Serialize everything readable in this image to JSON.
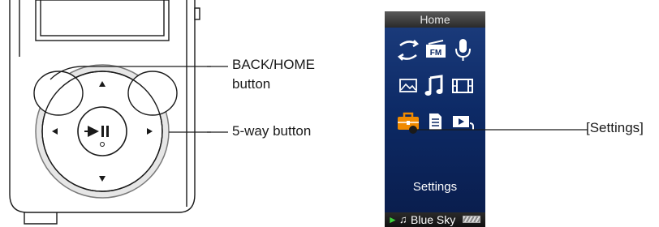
{
  "callouts": {
    "back_home_line1": "BACK/HOME",
    "back_home_line2": "button",
    "five_way": "5-way button",
    "settings": "[Settings]"
  },
  "screen": {
    "header": "Home",
    "selected_label": "Settings",
    "now_playing": "Blue Sky",
    "icons": [
      {
        "name": "shuffle-icon"
      },
      {
        "name": "fm-radio-icon"
      },
      {
        "name": "microphone-icon"
      },
      {
        "name": "photo-icon"
      },
      {
        "name": "music-note-icon"
      },
      {
        "name": "video-film-icon"
      },
      {
        "name": "settings-toolbox-icon"
      },
      {
        "name": "document-icon"
      },
      {
        "name": "playlist-icon"
      }
    ],
    "fm_text": "FM"
  },
  "colors": {
    "highlight": "#f08a00",
    "screen_bg": "#0d2a66",
    "play_green": "#3cd23c"
  }
}
